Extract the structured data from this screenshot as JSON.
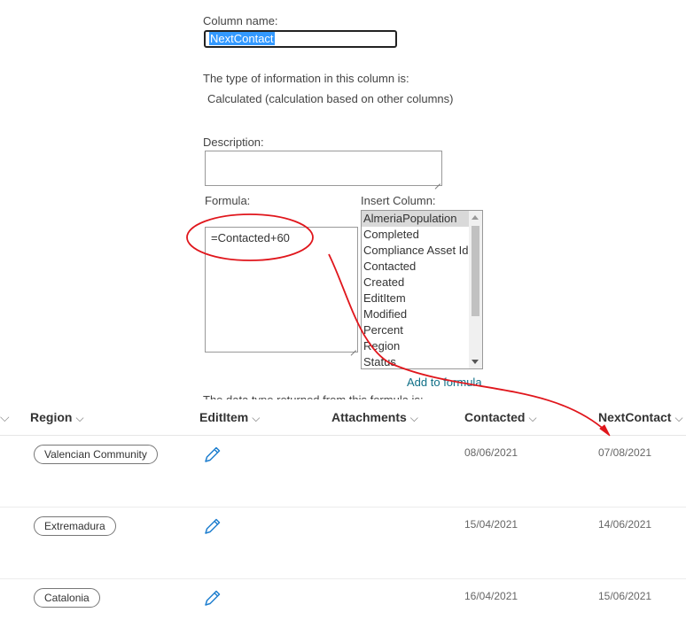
{
  "form": {
    "column_name_label": "Column name:",
    "column_name_value": "NextContact",
    "type_label": "The type of information in this column is:",
    "type_value": "Calculated (calculation based on other columns)",
    "description_label": "Description:",
    "formula_label": "Formula:",
    "formula_value": "=Contacted+60",
    "insert_column_label": "Insert Column:",
    "insert_columns": [
      "AlmeriaPopulation",
      "Completed",
      "Compliance Asset Id",
      "Contacted",
      "Created",
      "EditItem",
      "Modified",
      "Percent",
      "Region",
      "Status"
    ],
    "selected_insert_column": "AlmeriaPopulation",
    "add_to_formula": "Add to formula",
    "return_type_label": "The data type returned from this formula is:"
  },
  "list": {
    "columns": [
      "Region",
      "EditItem",
      "Attachments",
      "Contacted",
      "NextContact"
    ],
    "rows": [
      {
        "region": "Valencian Community",
        "contacted": "08/06/2021",
        "next_contact": "07/08/2021"
      },
      {
        "region": "Extremadura",
        "contacted": "15/04/2021",
        "next_contact": "14/06/2021"
      },
      {
        "region": "Catalonia",
        "contacted": "16/04/2021",
        "next_contact": "15/06/2021"
      }
    ]
  },
  "colors": {
    "annotation": "#e0161c",
    "link": "#0f6f87",
    "selection": "#3399ff",
    "pencil": "#1f7fcf"
  },
  "icons": {
    "edit": "pencil-icon",
    "sort": "chevron-down-icon"
  }
}
